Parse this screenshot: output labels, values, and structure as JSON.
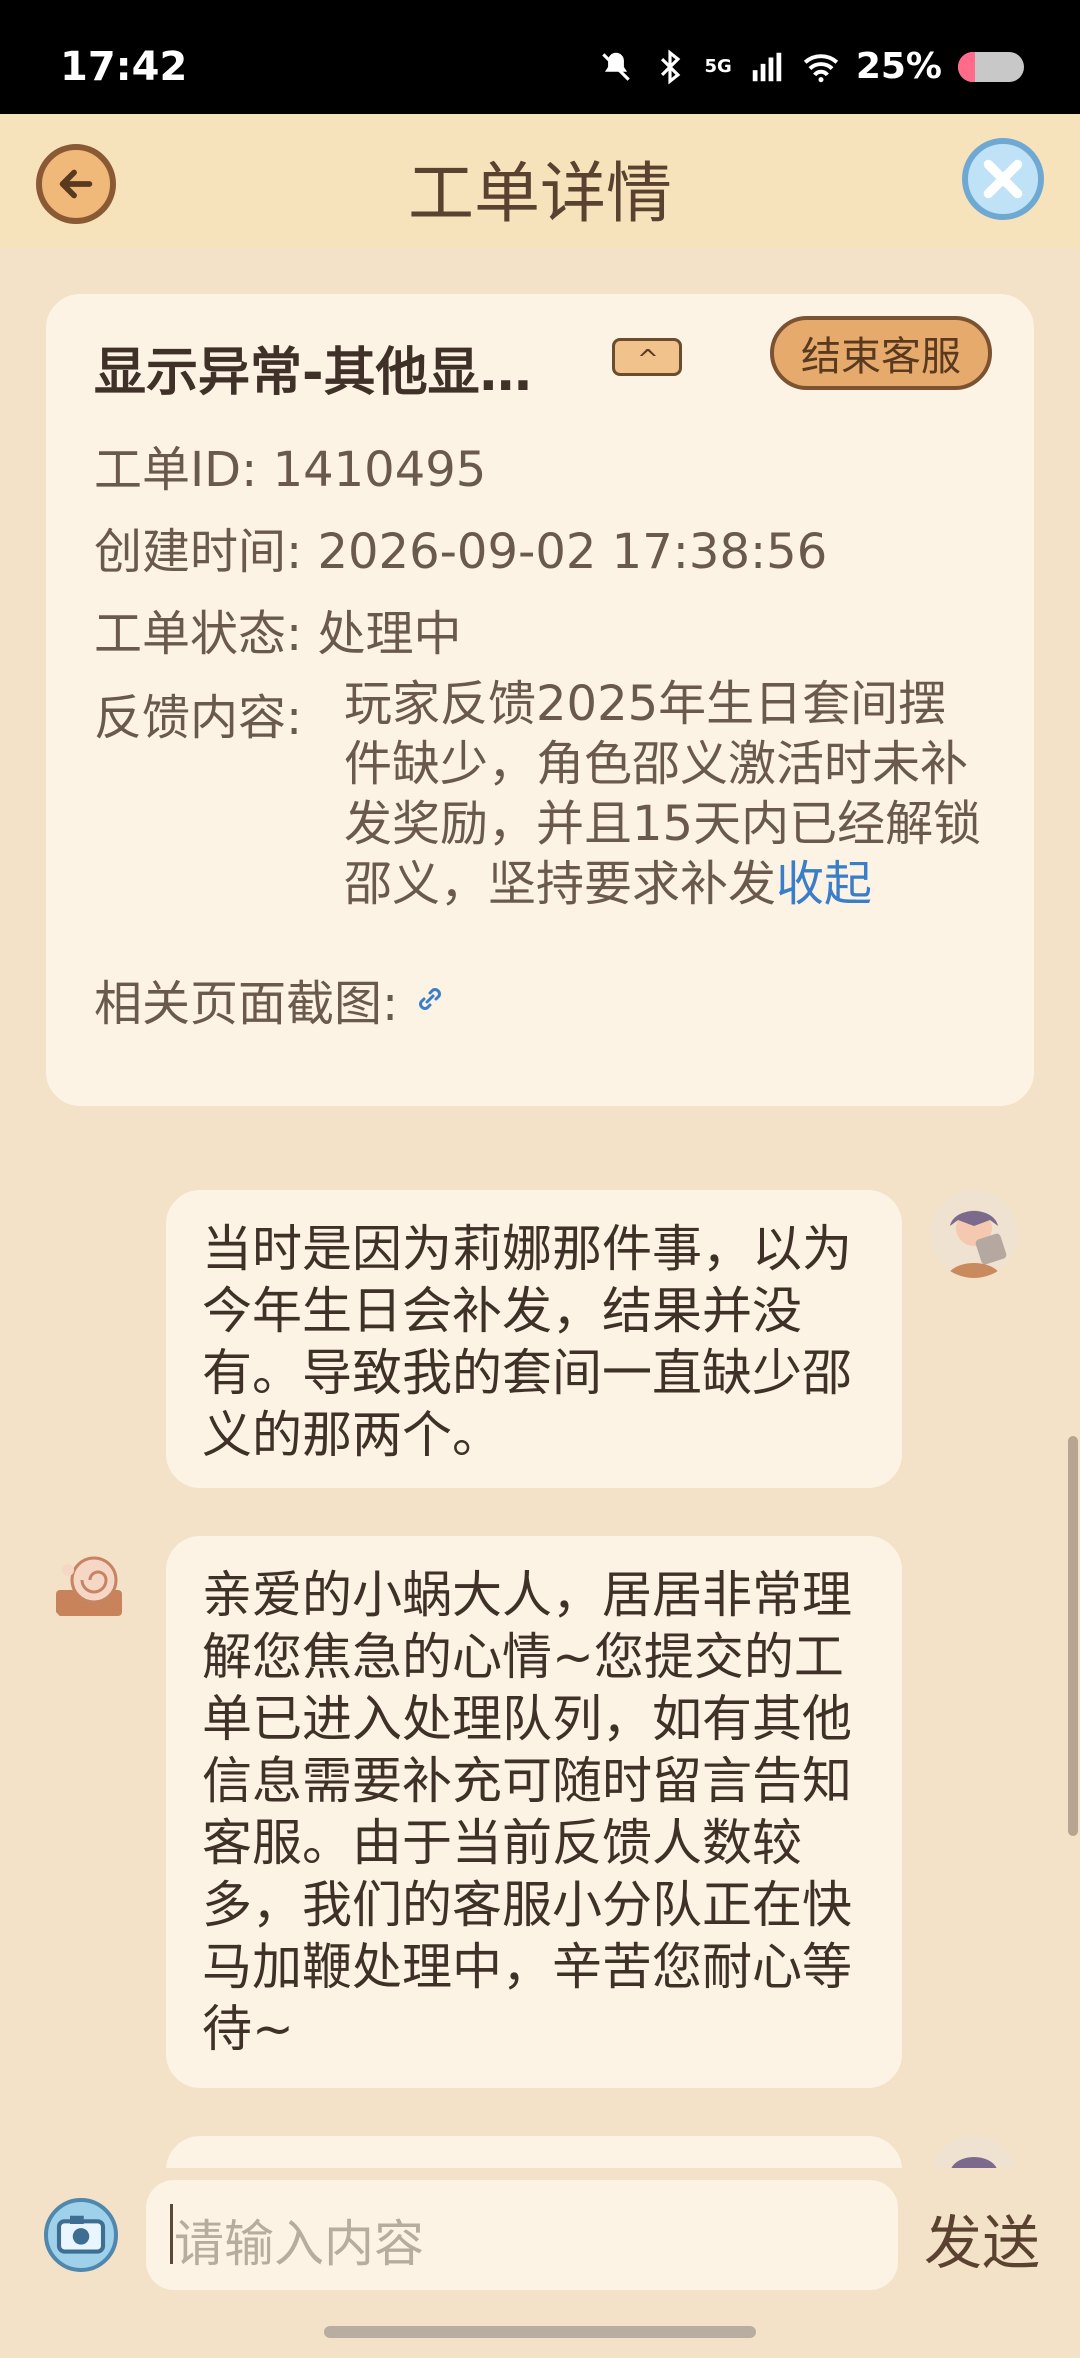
{
  "status_bar": {
    "time": "17:42",
    "network": "5G",
    "battery_percent": "25%",
    "battery_level": 0.25
  },
  "header": {
    "title": "工单详情",
    "back_icon": "arrow-left-icon",
    "close_icon": "close-icon"
  },
  "ticket": {
    "title": "显示异常-其他显…",
    "end_button": "结束客服",
    "id_label": "工单ID:",
    "id_value": "1410495",
    "created_label": "创建时间:",
    "created_value": "2026-09-02 17:38:56",
    "status_label": "工单状态:",
    "status_value": "处理中",
    "feedback_label": "反馈内容:",
    "feedback_text": "玩家反馈2025年生日套间摆件缺少，角色邵义激活时未补发奖励，并且15天内已经解锁邵义，坚持要求补发",
    "collapse_link": "收起",
    "screenshot_label": "相关页面截图:"
  },
  "messages": [
    {
      "side": "user",
      "text": "当时是因为莉娜那件事，以为今年生日会补发，结果并没有。导致我的套间一直缺少邵义的那两个。"
    },
    {
      "side": "agent",
      "text": "亲爱的小蜗大人，居居非常理解您焦急的心情~您提交的工单已进入处理队列，如有其他信息需要补充可随时留言告知客服。由于当前反馈人数较多，我们的客服小分队正在快马加鞭处理中，辛苦您耐心等待~"
    }
  ],
  "composer": {
    "placeholder": "请输入内容",
    "send_label": "发送",
    "camera_icon": "camera-icon"
  },
  "colors": {
    "background": "#f3e2c7",
    "header": "#f6e3bc",
    "card": "#fcf3e4",
    "accent_button": "#e7aa6d",
    "link": "#3a7dc8"
  }
}
